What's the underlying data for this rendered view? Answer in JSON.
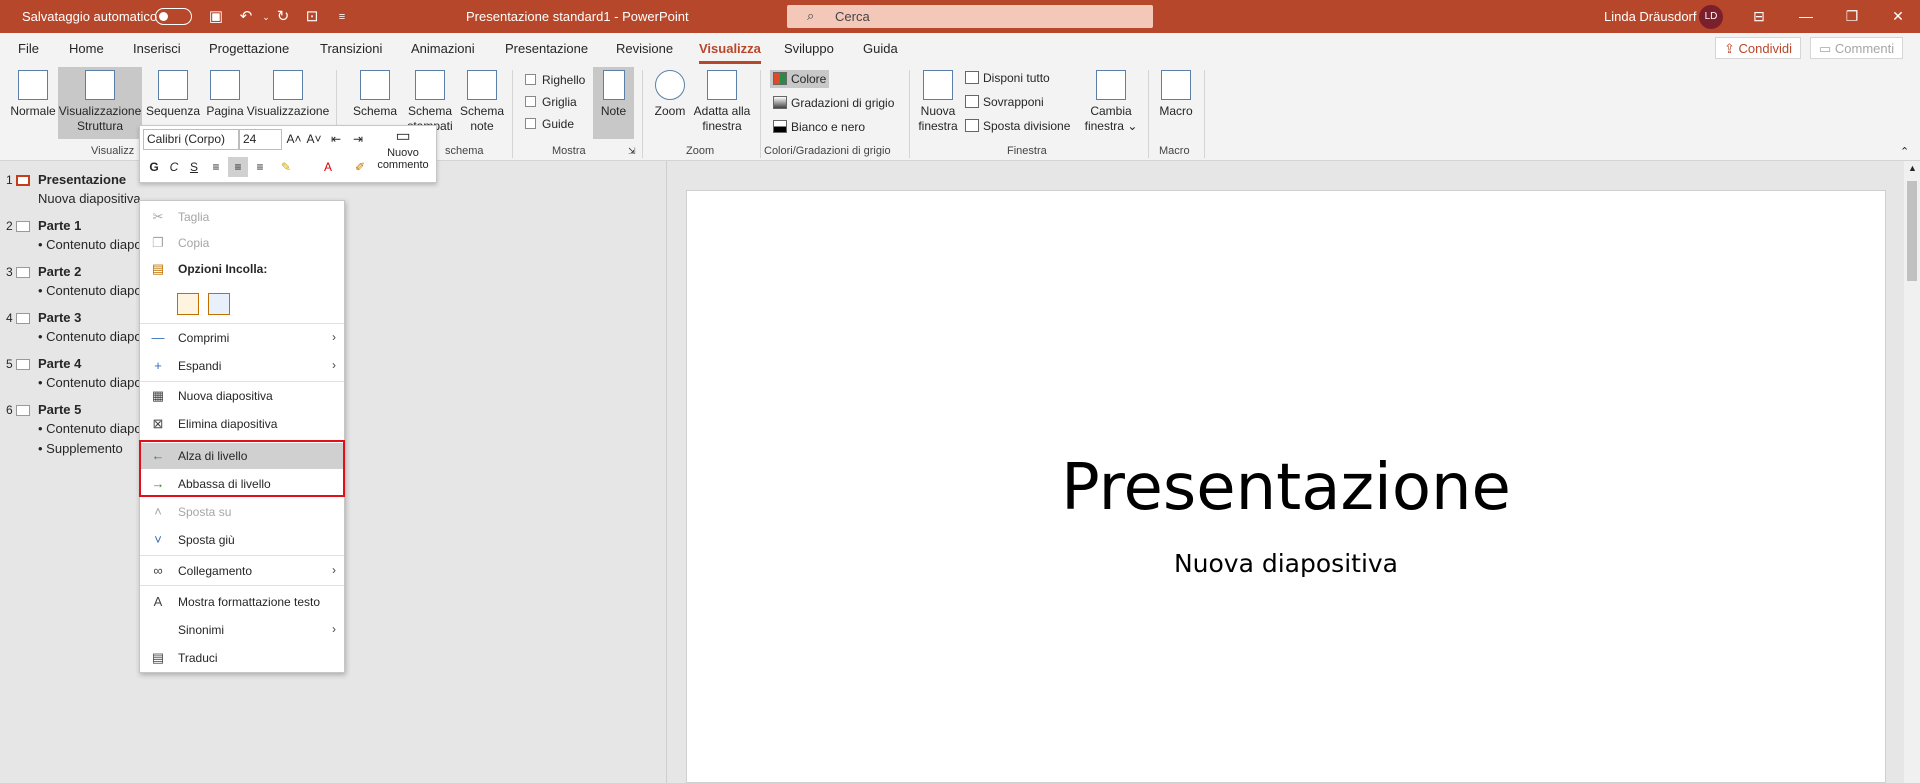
{
  "titlebar": {
    "autosave": "Salvataggio automatico",
    "title": "Presentazione standard1  -  PowerPoint",
    "search_placeholder": "Cerca",
    "user": "Linda Dräusdorf",
    "initials": "LD"
  },
  "tabs": [
    "File",
    "Home",
    "Inserisci",
    "Progettazione",
    "Transizioni",
    "Animazioni",
    "Presentazione",
    "Revisione",
    "Visualizza",
    "Sviluppo",
    "Guida"
  ],
  "active_tab": "Visualizza",
  "share": "Condividi",
  "comments": "Commenti",
  "ribbon": {
    "views": {
      "normale": "Normale",
      "struttura": "Visualizzazione Struttura",
      "sequenza": "Sequenza",
      "pagina": "Pagina",
      "lettura": "Visualizzazione",
      "group": "Visualizz"
    },
    "schema": {
      "schema": "Schema",
      "stampati": "Schema stampati",
      "note": "Schema note",
      "group": "schema"
    },
    "mostra": {
      "righello": "Righello",
      "griglia": "Griglia",
      "guide": "Guide",
      "note": "Note",
      "group": "Mostra"
    },
    "zoom": {
      "zoom": "Zoom",
      "adatta": "Adatta alla finestra",
      "group": "Zoom"
    },
    "colori": {
      "colore": "Colore",
      "grigio": "Gradazioni di grigio",
      "bn": "Bianco e nero",
      "group": "Colori/Gradazioni di grigio"
    },
    "finestra": {
      "nuova": "Nuova finestra",
      "disponi": "Disponi tutto",
      "sovrapponi": "Sovrapponi",
      "sposta": "Sposta divisione",
      "cambia": "Cambia finestra",
      "group": "Finestra"
    },
    "macro": {
      "macro": "Macro",
      "group": "Macro"
    }
  },
  "minitoolbar": {
    "font": "Calibri (Corpo)",
    "size": "24",
    "bold": "G",
    "italic": "C",
    "underline": "S",
    "nuovo_commento": "Nuovo commento"
  },
  "outline": [
    {
      "num": "1",
      "title": "Presentazione",
      "bullets": [
        "Nuova diapositiva"
      ]
    },
    {
      "num": "2",
      "title": "Parte 1",
      "bullets": [
        "• Contenuto diapo"
      ]
    },
    {
      "num": "3",
      "title": "Parte 2",
      "bullets": [
        "• Contenuto diapo"
      ]
    },
    {
      "num": "4",
      "title": "Parte 3",
      "bullets": [
        "• Contenuto diapo"
      ]
    },
    {
      "num": "5",
      "title": "Parte 4",
      "bullets": [
        "• Contenuto diapo"
      ]
    },
    {
      "num": "6",
      "title": "Parte 5",
      "bullets": [
        "• Contenuto diapo",
        "• Supplemento"
      ]
    }
  ],
  "context_menu": {
    "taglia": "Taglia",
    "copia": "Copia",
    "opzioni_incolla": "Opzioni Incolla:",
    "comprimi": "Comprimi",
    "espandi": "Espandi",
    "nuova": "Nuova diapositiva",
    "elimina": "Elimina diapositiva",
    "alza": "Alza di livello",
    "abbassa": "Abbassa di livello",
    "sposta_su": "Sposta su",
    "sposta_giu": "Sposta giù",
    "collegamento": "Collegamento",
    "mostra_formattazione": "Mostra formattazione testo",
    "sinonimi": "Sinonimi",
    "traduci": "Traduci"
  },
  "slide": {
    "title": "Presentazione",
    "subtitle": "Nuova diapositiva"
  },
  "colors": {
    "brand": "#b7472a",
    "highlight_box": "#e0101a"
  }
}
